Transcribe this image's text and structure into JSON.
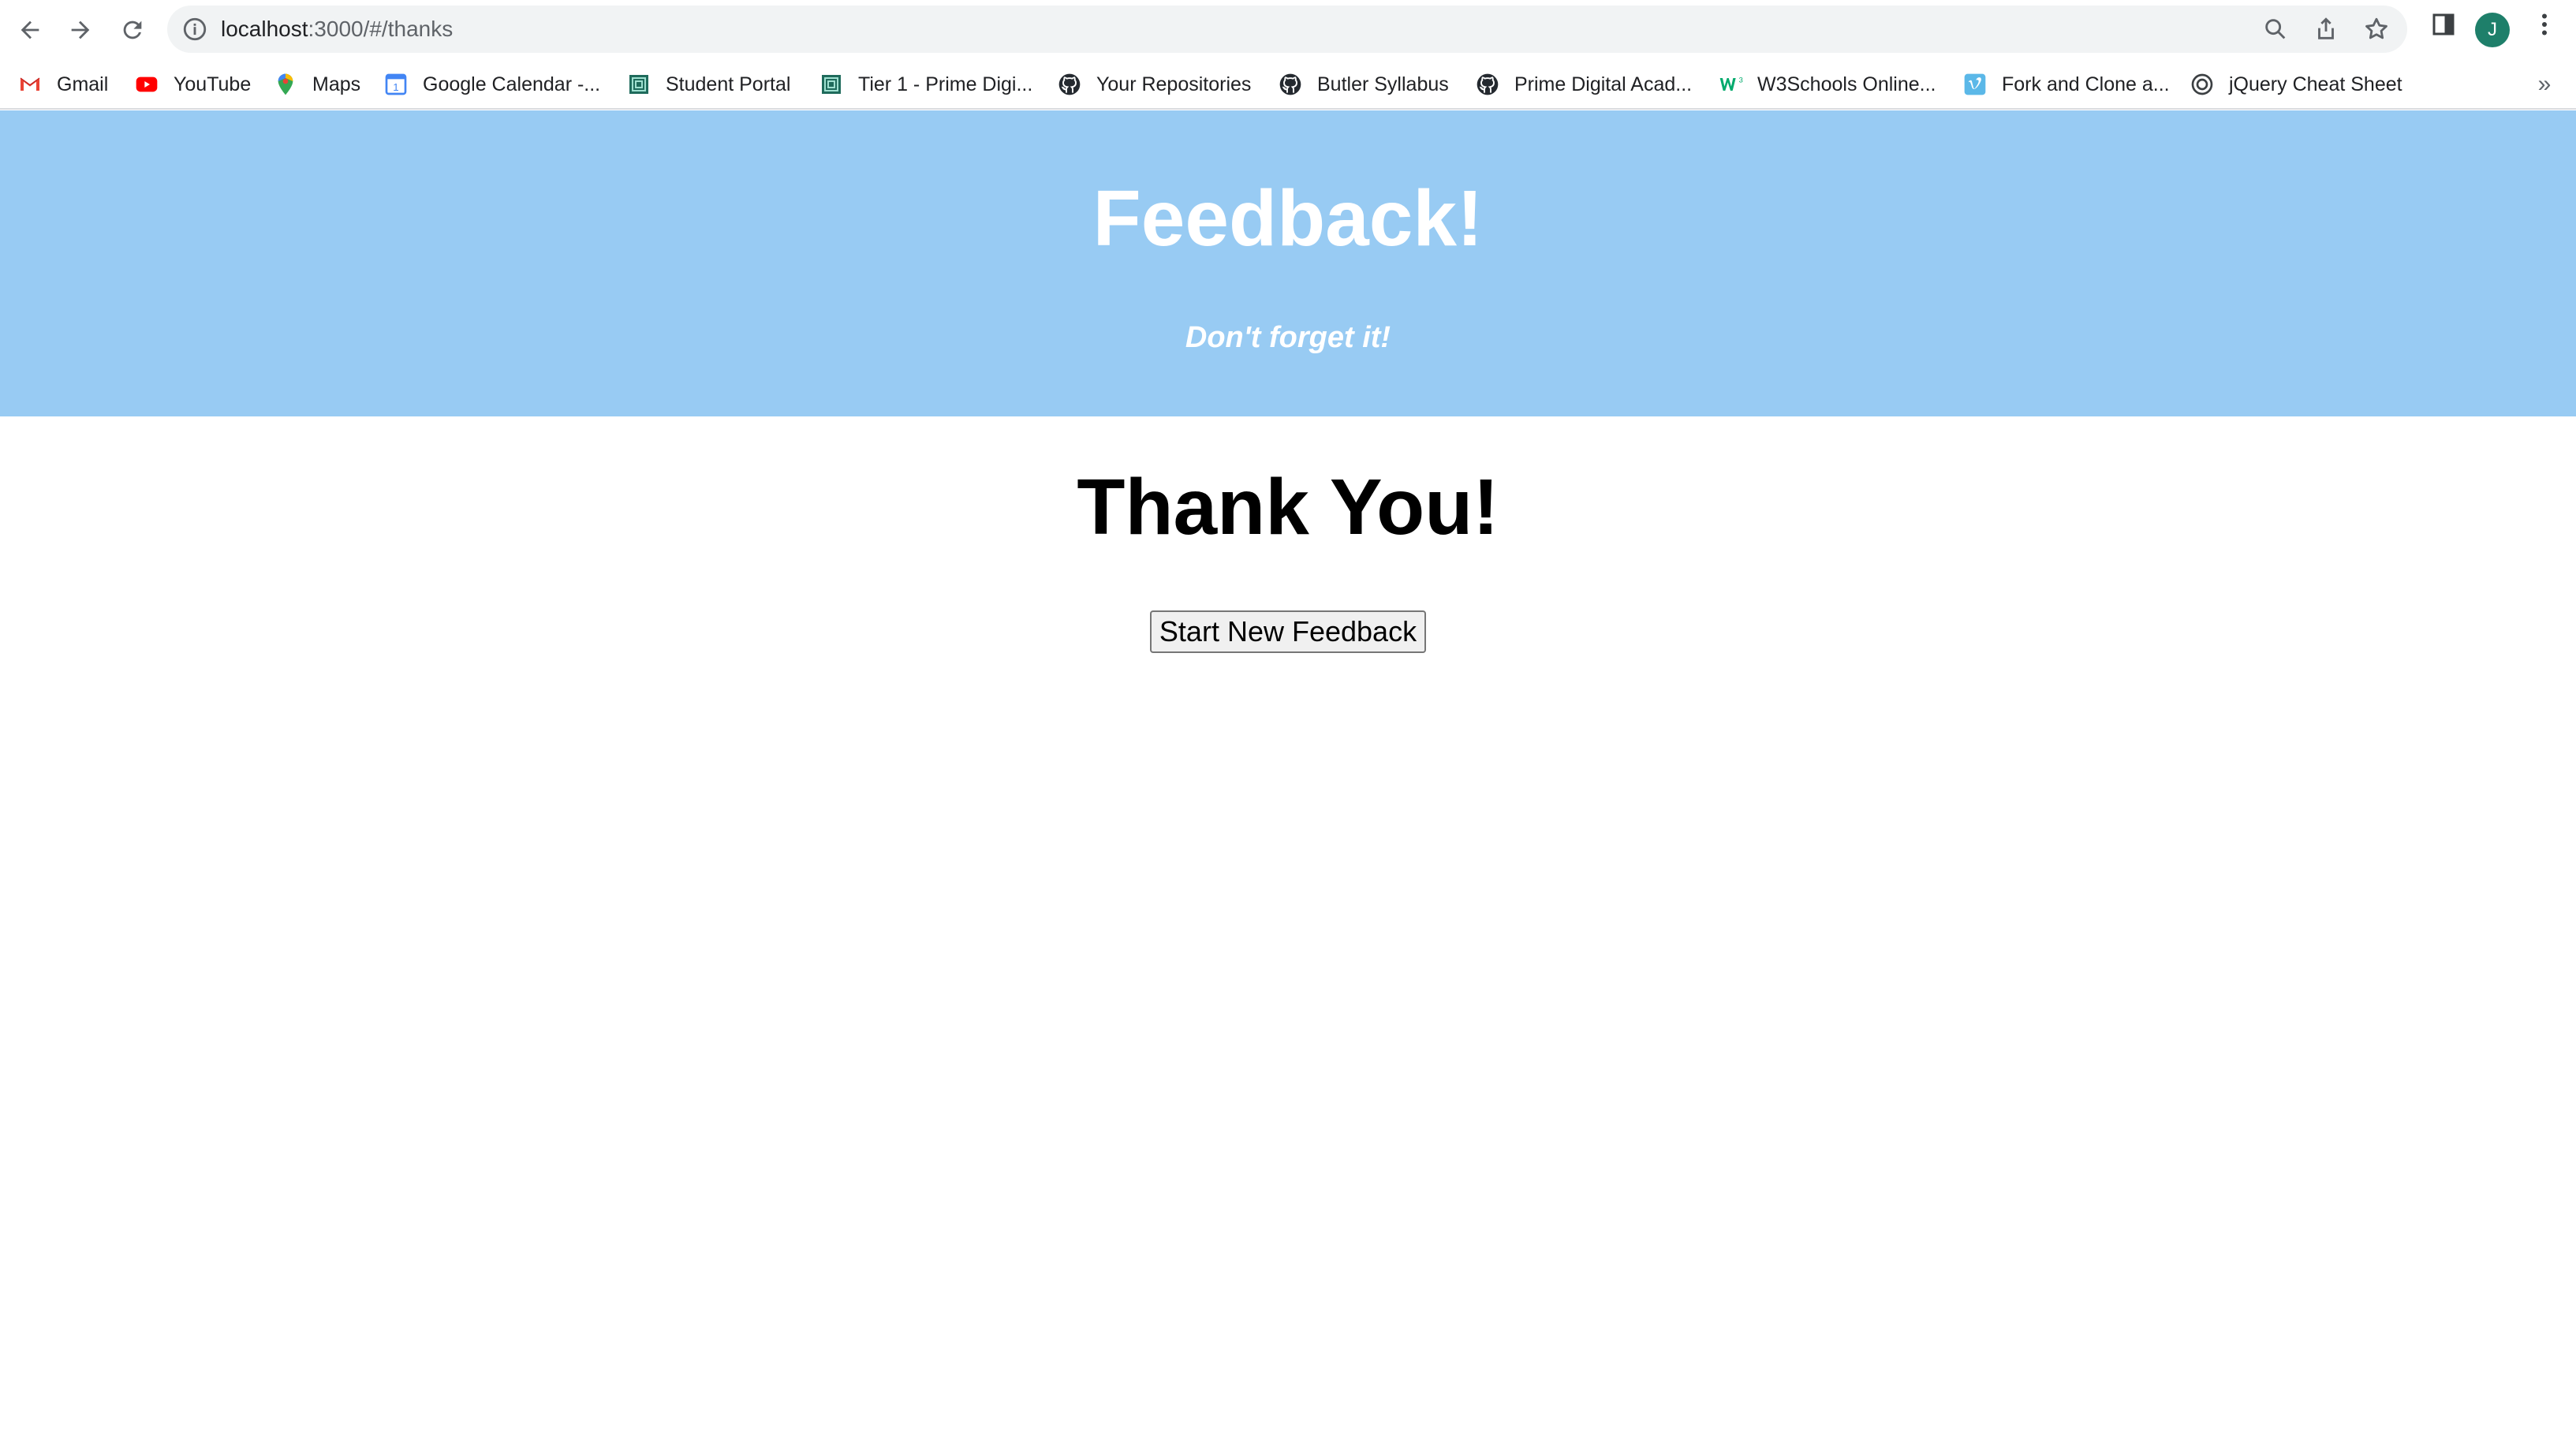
{
  "browser": {
    "url_host": "localhost",
    "url_path": ":3000/#/thanks",
    "profile_initial": "J",
    "bookmarks": [
      {
        "label": "Gmail",
        "icon": "gmail-icon"
      },
      {
        "label": "YouTube",
        "icon": "youtube-icon"
      },
      {
        "label": "Maps",
        "icon": "maps-icon"
      },
      {
        "label": "Google Calendar -...",
        "icon": "calendar-icon"
      },
      {
        "label": "Student Portal",
        "icon": "prime-icon"
      },
      {
        "label": "Tier 1 - Prime Digi...",
        "icon": "prime-icon"
      },
      {
        "label": "Your Repositories",
        "icon": "github-icon"
      },
      {
        "label": "Butler Syllabus",
        "icon": "github-icon"
      },
      {
        "label": "Prime Digital Acad...",
        "icon": "github-icon"
      },
      {
        "label": "W3Schools Online...",
        "icon": "w3schools-icon"
      },
      {
        "label": "Fork and Clone a...",
        "icon": "vimeo-icon"
      },
      {
        "label": "jQuery Cheat Sheet",
        "icon": "jquery-icon"
      }
    ],
    "more_bookmarks": "»"
  },
  "header": {
    "title": "Feedback!",
    "subtitle": "Don't forget it!"
  },
  "main": {
    "heading": "Thank You!",
    "button_label": "Start New Feedback"
  },
  "colors": {
    "header_bg": "#98cbf3",
    "header_text": "#ffffff",
    "avatar_bg": "#1e7f6a"
  }
}
